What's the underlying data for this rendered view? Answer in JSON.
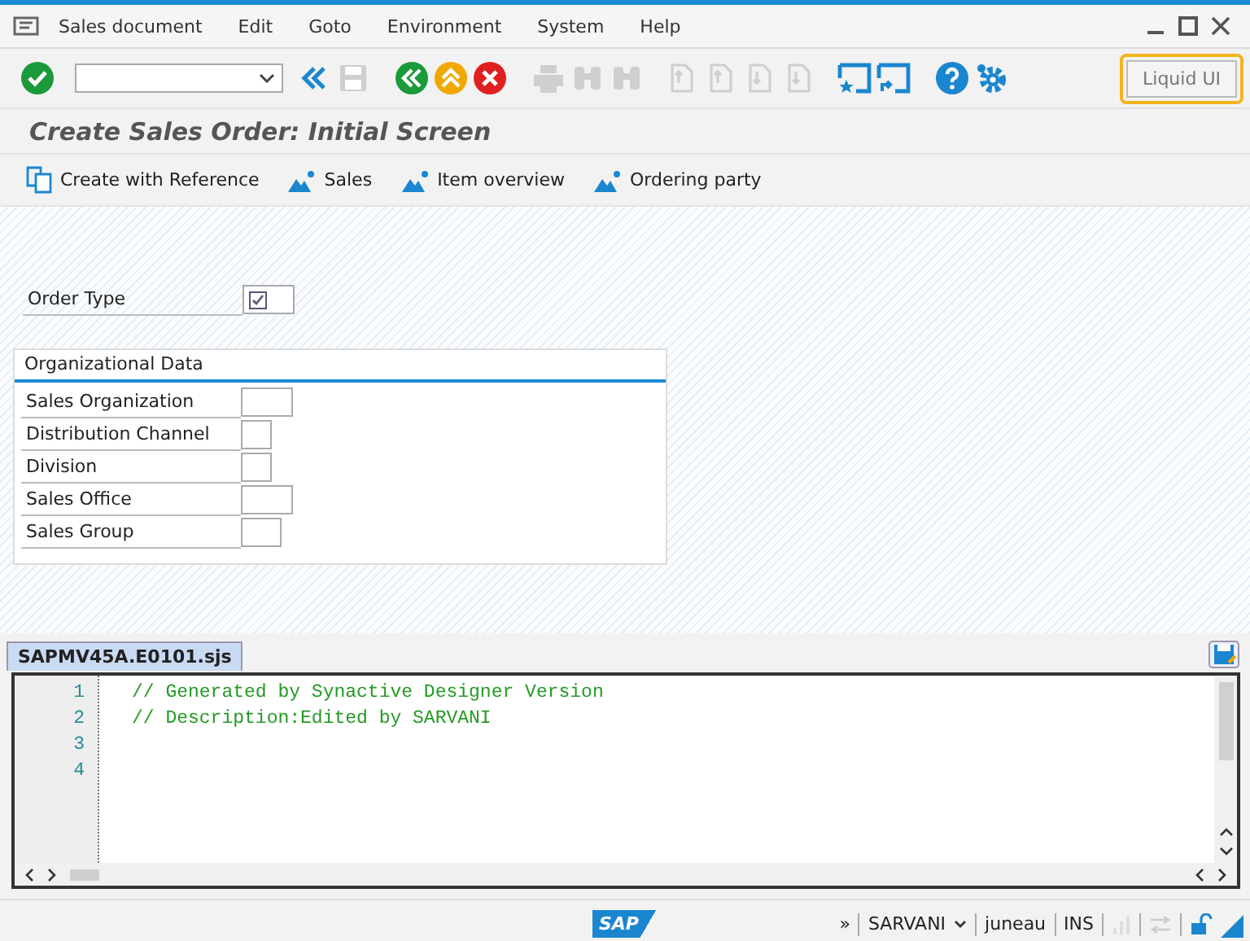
{
  "menu_bar": {
    "items": [
      "Sales document",
      "Edit",
      "Goto",
      "Environment",
      "System",
      "Help"
    ]
  },
  "toolbar": {
    "buttons": [
      {
        "kind": "enter",
        "disabled": false
      },
      {
        "kind": "command-field",
        "disabled": false
      },
      {
        "kind": "back",
        "disabled": false
      },
      {
        "kind": "save",
        "disabled": true
      },
      {
        "kind": "exit",
        "disabled": false
      },
      {
        "kind": "up",
        "disabled": false
      },
      {
        "kind": "cancel",
        "disabled": false
      },
      {
        "kind": "print",
        "disabled": true
      },
      {
        "kind": "find",
        "disabled": true
      },
      {
        "kind": "find-next",
        "disabled": true
      },
      {
        "kind": "page-first",
        "disabled": true
      },
      {
        "kind": "page-prev",
        "disabled": true
      },
      {
        "kind": "page-next",
        "disabled": true
      },
      {
        "kind": "page-last",
        "disabled": true
      },
      {
        "kind": "new-session",
        "disabled": false
      },
      {
        "kind": "shortcut",
        "disabled": false
      },
      {
        "kind": "help",
        "disabled": false
      },
      {
        "kind": "settings",
        "disabled": false
      }
    ],
    "liquid_ui_button": "Liquid UI"
  },
  "title": "Create Sales Order: Initial Screen",
  "app_toolbar": [
    {
      "kind": "reference",
      "label": "Create with Reference"
    },
    {
      "kind": "mountain",
      "label": "Sales"
    },
    {
      "kind": "mountain",
      "label": "Item overview"
    },
    {
      "kind": "mountain",
      "label": "Ordering party"
    }
  ],
  "order_type": {
    "label": "Order Type",
    "required": true
  },
  "organizational_data": {
    "title": "Organizational Data",
    "fields": [
      {
        "label": "Sales Organization"
      },
      {
        "label": "Distribution Channel"
      },
      {
        "label": "Division"
      },
      {
        "label": "Sales Office"
      },
      {
        "label": "Sales Group"
      }
    ]
  },
  "editor": {
    "tab": "SAPMV45A.E0101.sjs",
    "lines": [
      {
        "number": "1",
        "code": "// Generated by Synactive Designer Version"
      },
      {
        "number": "2",
        "code": "// Description:Edited by SARVANI"
      },
      {
        "number": "3"
      },
      {
        "number": "4"
      }
    ]
  },
  "status_bar": {
    "logo": "SAP",
    "more": "»",
    "user": "SARVANI",
    "server": "juneau",
    "mode": "INS"
  }
}
